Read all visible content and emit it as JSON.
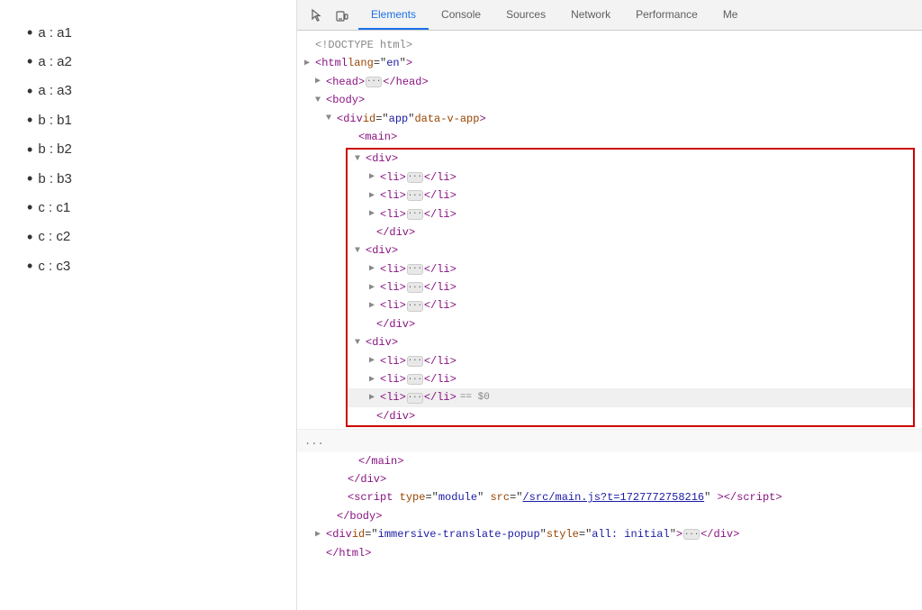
{
  "page": {
    "items": [
      {
        "label": "a : a1"
      },
      {
        "label": "a : a2"
      },
      {
        "label": "a : a3"
      },
      {
        "label": "b : b1"
      },
      {
        "label": "b : b2"
      },
      {
        "label": "b : b3"
      },
      {
        "label": "c : c1"
      },
      {
        "label": "c : c2"
      },
      {
        "label": "c : c3"
      }
    ]
  },
  "devtools": {
    "tabs": [
      {
        "label": "Elements",
        "active": true
      },
      {
        "label": "Console",
        "active": false
      },
      {
        "label": "Sources",
        "active": false
      },
      {
        "label": "Network",
        "active": false
      },
      {
        "label": "Performance",
        "active": false
      },
      {
        "label": "Me",
        "active": false
      }
    ],
    "dom": {
      "doctype": "<!DOCTYPE html>",
      "html_open": "<html lang=\"en\">",
      "head_line": "▶ <head>·····</head>",
      "body_open": "▼ <body>",
      "div_app_open": "▼ <div id=\"app\" data-v-app>",
      "main_open": "<main>",
      "highlighted_group": {
        "div1_open": "▼ <div>",
        "li_items_1": [
          "▶ <li>···</li>",
          "▶ <li>···</li>",
          "▶ <li>···</li>"
        ],
        "div1_close": "</div>",
        "div2_open": "▼ <div>",
        "li_items_2": [
          "▶ <li>···</li>",
          "▶ <li>···</li>",
          "▶ <li>···</li>"
        ],
        "div2_close": "</div>",
        "div3_open": "▼ <div>",
        "li_items_3": [
          "▶ <li>···</li>",
          "▶ <li>···</li>"
        ],
        "li_last": "▶ <li>···</li>",
        "div3_close": "</div>"
      },
      "main_close": "</main>",
      "div_app_close": "</div>",
      "script_line": "<script type=\"module\" src=\"/src/main.js?t=1727772758216\"><\\/script>",
      "body_close": "</body>",
      "div_immersive": "▶ <div id=\"immersive-translate-popup\" style=\"all: initial\">···</div>",
      "html_close": "</html>"
    }
  }
}
